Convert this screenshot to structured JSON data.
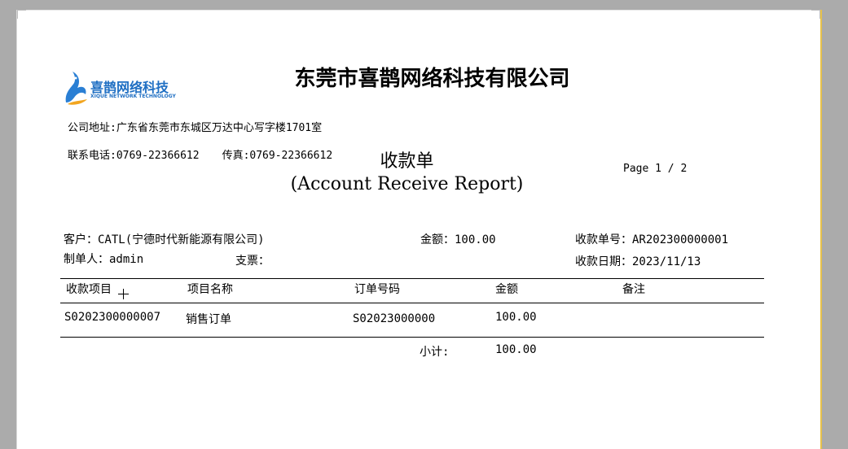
{
  "header": {
    "company_name": "东莞市喜鹊网络科技有限公司",
    "logo_text": "喜鹊网络科技",
    "logo_sub": "XIQUE NETWORK TECHNOLOGY",
    "address": "公司地址:广东省东莞市东城区万达中心写字楼1701室",
    "phone": "联系电话:0769-22366612",
    "fax": "传真:0769-22366612",
    "title": "收款单",
    "subtitle": "(Account Receive Report)",
    "page": "Page 1 / 2"
  },
  "info": {
    "customer": "客户：CATL(宁德时代新能源有限公司)",
    "amount": "金额：100.00",
    "receipt_no": "收款单号：AR202300000001",
    "creator": "制单人：admin",
    "cheque": "支票：",
    "receipt_date": "收款日期：2023/11/13"
  },
  "table": {
    "headers": [
      "收款项目",
      "项目名称",
      "订单号码",
      "金额",
      "备注"
    ],
    "rows": [
      [
        "S0202300000007",
        "销售订单",
        "S02023000000",
        "100.00",
        ""
      ]
    ],
    "subtotal_label": "小计:",
    "subtotal_value": "100.00"
  },
  "colors": {
    "background": "#ababab",
    "page": "#ffffff",
    "page_right_border": "#e8c24a",
    "logo_blue": "#1f6fc3"
  }
}
